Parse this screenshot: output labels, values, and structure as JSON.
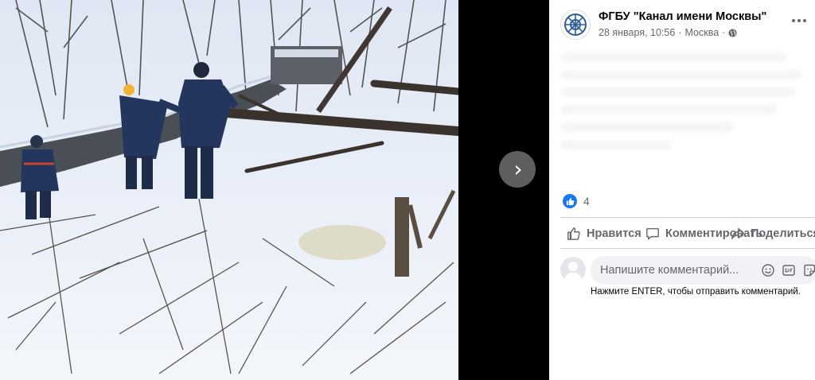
{
  "post": {
    "page_name": "ФГБУ \"Канал имени Москвы\"",
    "date": "28 января, 10:56",
    "separator": "·",
    "location": "Москва",
    "separator2": "·"
  },
  "icons": {
    "avatar": "ship-wheel-icon",
    "privacy": "globe-icon",
    "more": "more-options-icon",
    "next": "chevron-right-icon",
    "like": "thumbs-up-icon",
    "comment": "comment-icon",
    "share": "share-icon",
    "emoji": "emoji-icon",
    "gif": "gif-icon",
    "sticker": "sticker-icon"
  },
  "reactions": {
    "count": "4"
  },
  "actions": {
    "like_label": "Нравится",
    "comment_label": "Комментировать",
    "share_label": "Поделиться"
  },
  "comment": {
    "placeholder": "Напишите комментарий...",
    "hint": "Нажмите ENTER, чтобы отправить комментарий."
  },
  "viewer": {
    "next_glyph": "›"
  },
  "colors": {
    "accent": "#1877f2",
    "secondary_text": "#65676b",
    "input_bg": "#f0f2f5"
  }
}
